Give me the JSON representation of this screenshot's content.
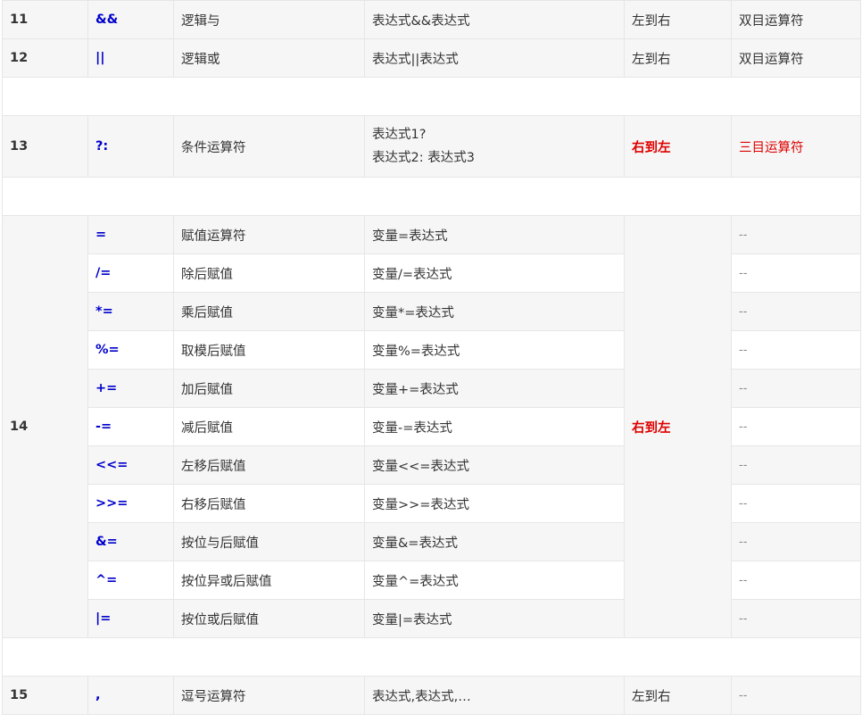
{
  "rows_top": [
    {
      "prec": "11",
      "op": "&&",
      "name": "逻辑与",
      "usage": "表达式&&表达式",
      "dir": "左到右",
      "note": "双目运算符"
    },
    {
      "prec": "12",
      "op": "||",
      "name": "逻辑或",
      "usage": "表达式||表达式",
      "dir": "左到右",
      "note": "双目运算符"
    }
  ],
  "row13": {
    "prec": "13",
    "op": "?:",
    "name": "条件运算符",
    "usage_line1": "表达式1?",
    "usage_line2": "表达式2: 表达式3",
    "dir": "右到左",
    "note": "三目运算符"
  },
  "group14": {
    "prec": "14",
    "dir": "右到左",
    "rows": [
      {
        "op": "=",
        "name": "赋值运算符",
        "usage": "变量=表达式",
        "note": "--"
      },
      {
        "op": "/=",
        "name": "除后赋值",
        "usage": "变量/=表达式",
        "note": "--"
      },
      {
        "op": "*=",
        "name": "乘后赋值",
        "usage": "变量*=表达式",
        "note": "--"
      },
      {
        "op": "%=",
        "name": "取模后赋值",
        "usage": "变量%=表达式",
        "note": "--"
      },
      {
        "op": "+=",
        "name": "加后赋值",
        "usage": "变量+=表达式",
        "note": "--"
      },
      {
        "op": "-=",
        "name": "减后赋值",
        "usage": "变量-=表达式",
        "note": "--"
      },
      {
        "op": "<<=",
        "name": "左移后赋值",
        "usage": "变量<<=表达式",
        "note": "--"
      },
      {
        "op": ">>=",
        "name": "右移后赋值",
        "usage": "变量>>=表达式",
        "note": "--"
      },
      {
        "op": "&=",
        "name": "按位与后赋值",
        "usage": "变量&=表达式",
        "note": "--"
      },
      {
        "op": "^=",
        "name": "按位异或后赋值",
        "usage": "变量^=表达式",
        "note": "--"
      },
      {
        "op": "|=",
        "name": "按位或后赋值",
        "usage": "变量|=表达式",
        "note": "--"
      }
    ]
  },
  "row15": {
    "prec": "15",
    "op": ",",
    "name": "逗号运算符",
    "usage": "表达式,表达式,…",
    "dir": "左到右",
    "note": "--"
  },
  "colors": {
    "operator": "#0000cc",
    "emphasis": "#dd0000",
    "row_shade": "#f6f6f6",
    "border": "#e6e6e6"
  }
}
